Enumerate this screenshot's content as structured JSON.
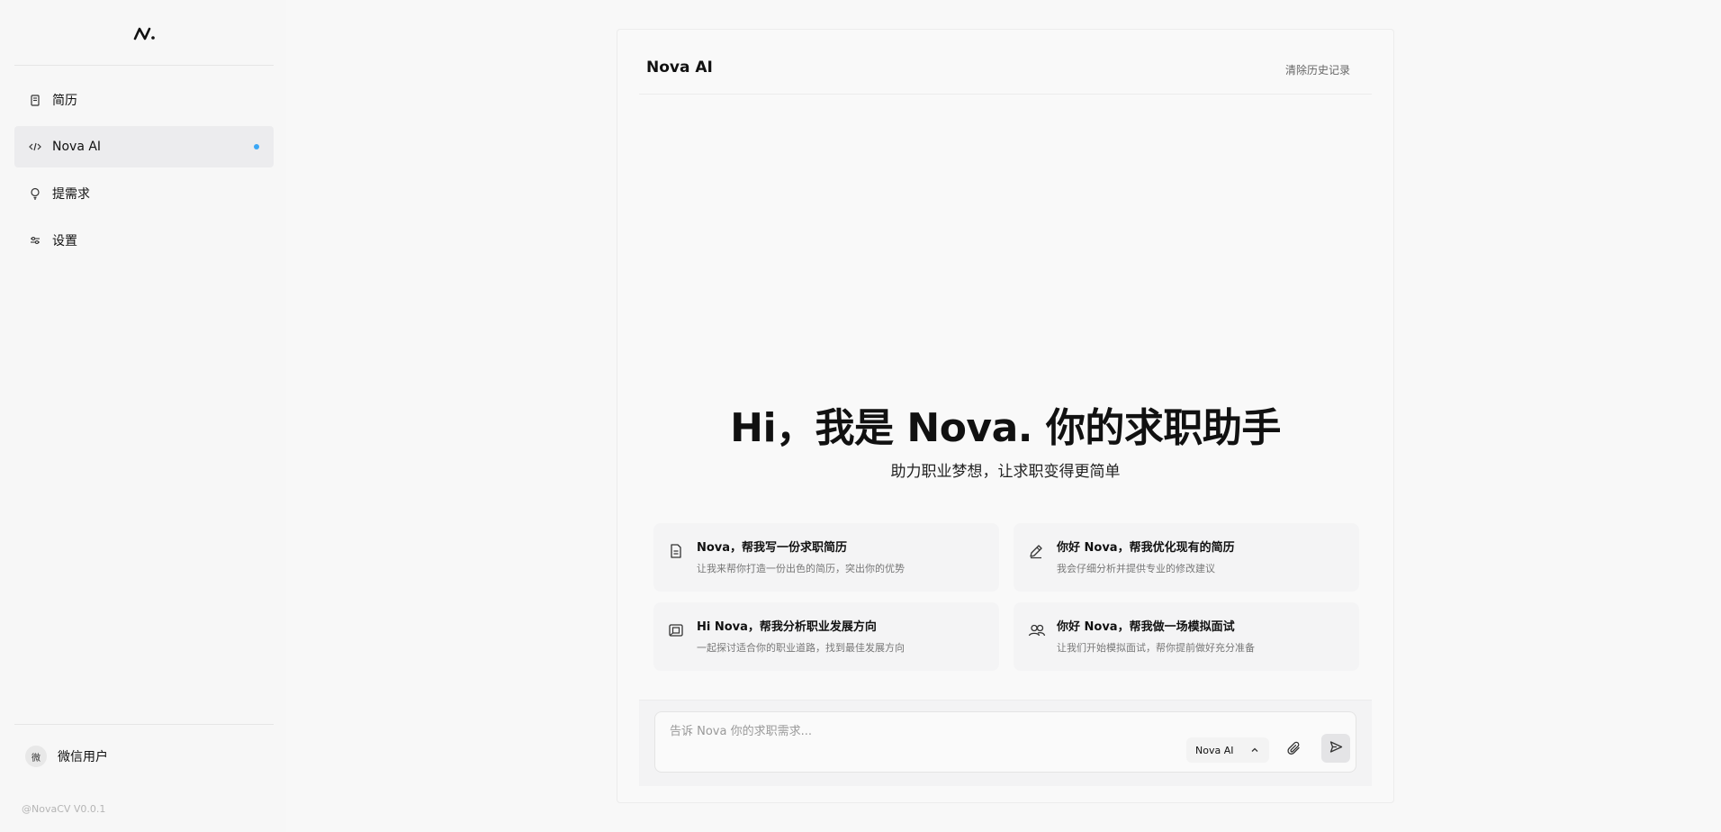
{
  "sidebar": {
    "items": [
      {
        "label": "简历",
        "icon": "document-icon"
      },
      {
        "label": "Nova AI",
        "icon": "code-icon"
      },
      {
        "label": "提需求",
        "icon": "lightbulb-icon"
      },
      {
        "label": "设置",
        "icon": "sliders-icon"
      }
    ],
    "user": {
      "avatar_text": "微",
      "name": "微信用户"
    },
    "version": "@NovaCV V0.0.1"
  },
  "panel": {
    "title": "Nova AI",
    "clear_history": "清除历史记录",
    "hero_title": "Hi，我是 Nova. 你的求职助手",
    "hero_subtitle": "助力职业梦想，让求职变得更简单",
    "cards": [
      {
        "title": "Nova，帮我写一份求职简历",
        "desc": "让我来帮你打造一份出色的简历，突出你的优势",
        "icon": "file-icon"
      },
      {
        "title": "你好 Nova，帮我优化现有的简历",
        "desc": "我会仔细分析并提供专业的修改建议",
        "icon": "pen-icon"
      },
      {
        "title": "Hi Nova，帮我分析职业发展方向",
        "desc": "一起探讨适合你的职业道路，找到最佳发展方向",
        "icon": "compass-icon"
      },
      {
        "title": "你好 Nova，帮我做一场模拟面试",
        "desc": "让我们开始模拟面试，帮你提前做好充分准备",
        "icon": "users-icon"
      }
    ],
    "composer": {
      "placeholder": "告诉 Nova 你的求职需求...",
      "model": "Nova AI"
    }
  },
  "colors": {
    "accent_dot": "#3ba7f5"
  }
}
